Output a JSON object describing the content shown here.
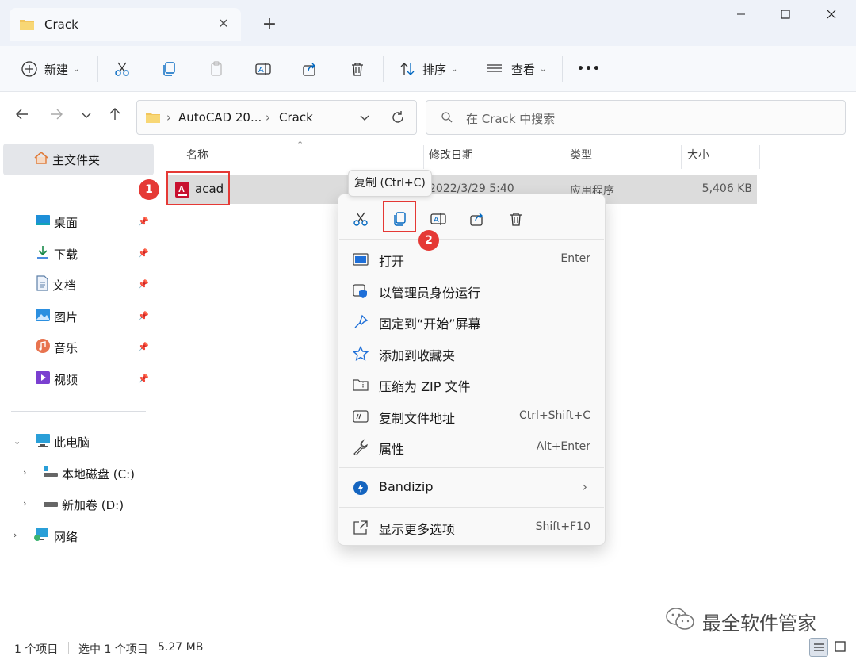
{
  "window": {
    "tab_title": "Crack",
    "new_tab_symbol": "+",
    "close_tab_symbol": "✕"
  },
  "toolbar": {
    "new_label": "新建",
    "sort_label": "排序",
    "view_label": "查看",
    "more_label": "•••"
  },
  "address": {
    "crumbs": [
      "AutoCAD 20...",
      "Crack"
    ],
    "search_placeholder": "在 Crack 中搜索"
  },
  "sidebar": {
    "home": "主文件夹",
    "quick": [
      {
        "label": "桌面",
        "icon": "desktop-icon"
      },
      {
        "label": "下载",
        "icon": "download-icon"
      },
      {
        "label": "文档",
        "icon": "document-icon"
      },
      {
        "label": "图片",
        "icon": "picture-icon"
      },
      {
        "label": "音乐",
        "icon": "music-icon"
      },
      {
        "label": "视频",
        "icon": "video-icon"
      }
    ],
    "this_pc": "此电脑",
    "drives": [
      "本地磁盘 (C:)",
      "新加卷 (D:)"
    ],
    "network": "网络"
  },
  "columns": {
    "name": "名称",
    "modified": "修改日期",
    "type": "类型",
    "size": "大小"
  },
  "file": {
    "name": "acad",
    "modified": "2022/3/29 5:40",
    "type": "应用程序",
    "size": "5,406 KB"
  },
  "tooltip": "复制 (Ctrl+C)",
  "badges": [
    "1",
    "2"
  ],
  "context_menu": {
    "items": [
      {
        "label": "打开",
        "shortcut": "Enter"
      },
      {
        "label": "以管理员身份运行",
        "shortcut": ""
      },
      {
        "label": "固定到“开始”屏幕",
        "shortcut": ""
      },
      {
        "label": "添加到收藏夹",
        "shortcut": ""
      },
      {
        "label": "压缩为 ZIP 文件",
        "shortcut": ""
      },
      {
        "label": "复制文件地址",
        "shortcut": "Ctrl+Shift+C"
      },
      {
        "label": "属性",
        "shortcut": "Alt+Enter"
      }
    ],
    "bandizip": "Bandizip",
    "more": {
      "label": "显示更多选项",
      "shortcut": "Shift+F10"
    }
  },
  "status": {
    "count": "1 个项目",
    "selection": "选中 1 个项目",
    "selection_size": "5.27 MB"
  },
  "watermark": "最全软件管家",
  "colors": {
    "accent": "#0067c0",
    "highlight_red": "#e53935",
    "folder": "#f2c55c",
    "autocad_red": "#c8102e"
  }
}
